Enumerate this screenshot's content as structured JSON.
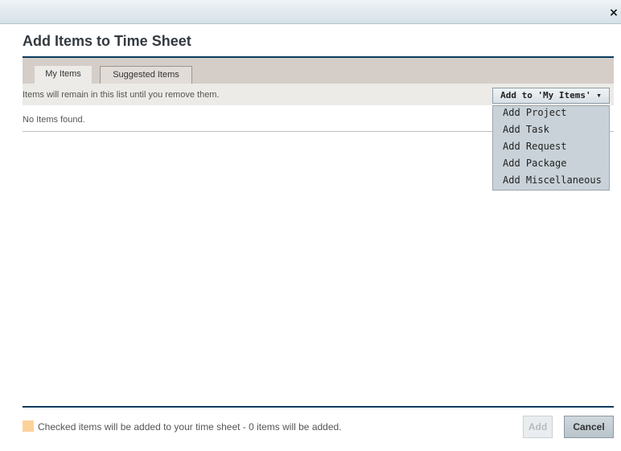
{
  "dialog": {
    "title": "Add Items to Time Sheet",
    "close_glyph": "×"
  },
  "tabs": [
    {
      "label": "My Items",
      "active": true
    },
    {
      "label": "Suggested Items",
      "active": false
    }
  ],
  "info_text": "Items will remain in this list until you remove them.",
  "add_dropdown": {
    "label": "Add to 'My Items' ▾",
    "items": [
      "Add Project",
      "Add Task",
      "Add Request",
      "Add Package",
      "Add Miscellaneous"
    ]
  },
  "list": {
    "empty_text": "No Items found."
  },
  "footer": {
    "legend_text": "Checked items will be added to your time sheet - 0 items will be added.",
    "legend_color": "#fcd29b",
    "add_label": "Add",
    "cancel_label": "Cancel"
  },
  "colors": {
    "accent": "#0b3c5d",
    "tab_strip": "#d5cdc8",
    "menu_bg": "#c9d2d8"
  }
}
